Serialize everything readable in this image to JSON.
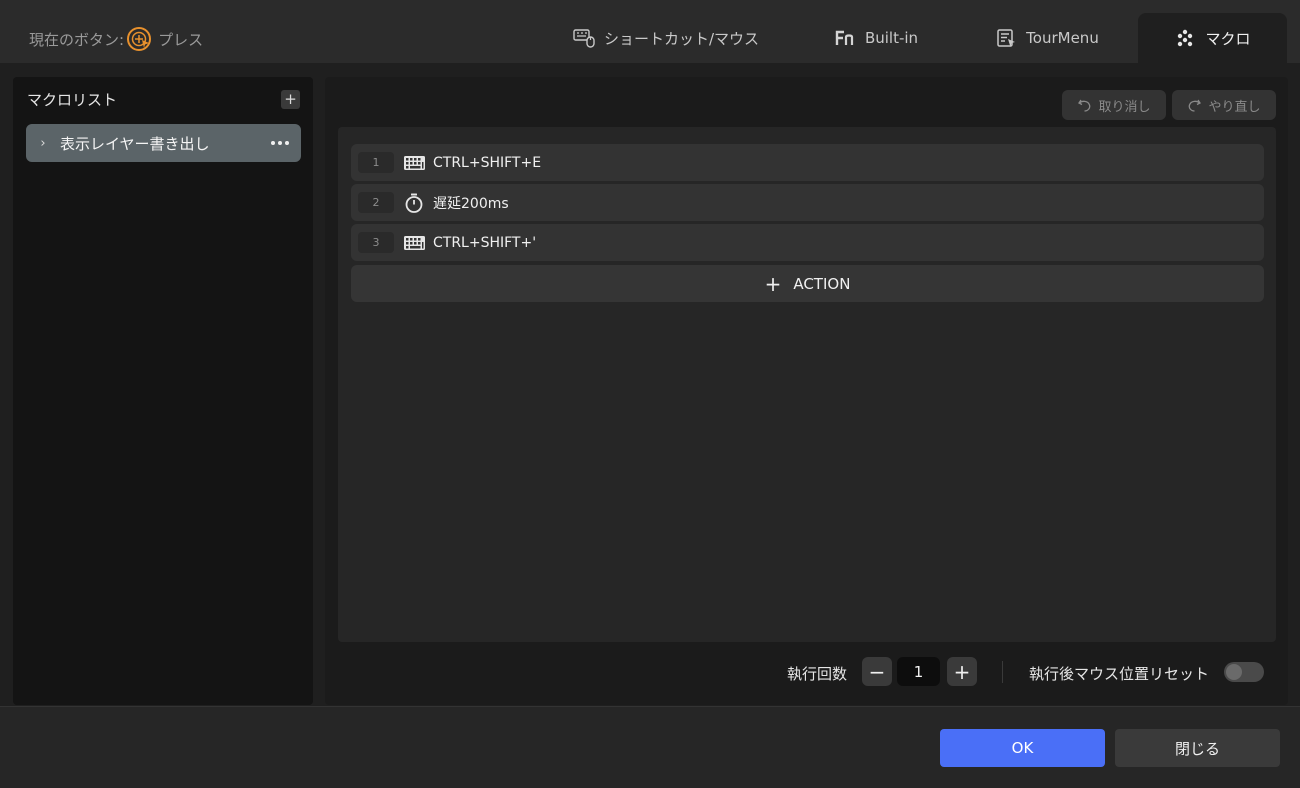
{
  "header": {
    "current_button_label": "現在のボタン:",
    "current_button_value": "プレス",
    "tabs": [
      {
        "label": "ショートカット/マウス",
        "icon": "keyboard-mouse-icon",
        "active": false
      },
      {
        "label": "Built-in",
        "icon": "fn-icon",
        "active": false
      },
      {
        "label": "TourMenu",
        "icon": "tour-menu-icon",
        "active": false
      },
      {
        "label": "マクロ",
        "icon": "macro-dots-icon",
        "active": true
      }
    ]
  },
  "left_panel": {
    "title": "マクロリスト",
    "add_label": "+",
    "items": [
      {
        "label": "表示レイヤー書き出し"
      }
    ]
  },
  "right_panel": {
    "undo_label": "取り消し",
    "redo_label": "やり直し",
    "actions": [
      {
        "index": "1",
        "icon": "keyboard-icon",
        "text": "CTRL+SHIFT+E"
      },
      {
        "index": "2",
        "icon": "stopwatch-icon",
        "text": "遅延200ms"
      },
      {
        "index": "3",
        "icon": "keyboard-icon",
        "text": "CTRL+SHIFT+'"
      }
    ],
    "add_action_label": "ACTION",
    "run_count_label": "執行回数",
    "run_count_value": "1",
    "reset_label": "執行後マウス位置リセット",
    "reset_enabled": false
  },
  "footer": {
    "ok_label": "OK",
    "close_label": "閉じる"
  },
  "colors": {
    "accent": "#4a6ff7",
    "selected_item": "#5b6468",
    "icon_orange": "#e8912d"
  }
}
